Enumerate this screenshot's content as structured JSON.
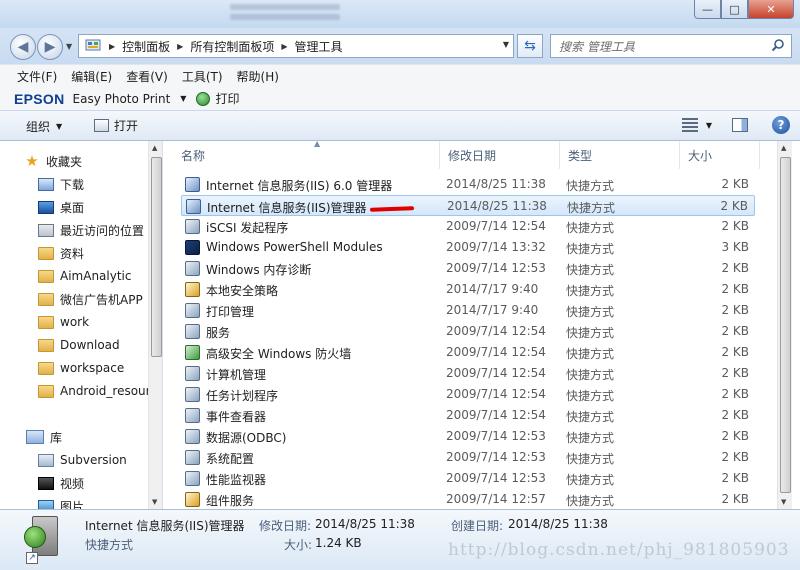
{
  "window": {
    "minimize_label": "—",
    "maximize_label": "□",
    "close_label": "✕"
  },
  "address": {
    "crumbs": [
      "控制面板",
      "所有控制面板项",
      "管理工具"
    ],
    "search_placeholder": "搜索 管理工具"
  },
  "menubar": {
    "items": [
      "文件(F)",
      "编辑(E)",
      "查看(V)",
      "工具(T)",
      "帮助(H)"
    ]
  },
  "epson": {
    "logo": "EPSON",
    "app": "Easy Photo Print",
    "print": "打印"
  },
  "commandbar": {
    "organize": "组织",
    "open": "打开",
    "help": "?"
  },
  "navigation": {
    "favorites_header": "收藏夹",
    "favorites": [
      "下载",
      "桌面",
      "最近访问的位置",
      "资料",
      "AimAnalytic",
      "微信广告机APP",
      "work",
      "Download",
      "workspace",
      "Android_resour"
    ],
    "library_header": "库",
    "library": [
      "Subversion",
      "视频",
      "图片"
    ]
  },
  "columns": {
    "name": "名称",
    "date": "修改日期",
    "type": "类型",
    "size": "大小"
  },
  "files": [
    {
      "name": "Internet 信息服务(IIS) 6.0 管理器",
      "date": "2014/8/25 11:38",
      "type": "快捷方式",
      "size": "2 KB",
      "icon": "iis6-manager-icon"
    },
    {
      "name": "Internet 信息服务(IIS)管理器",
      "date": "2014/8/25 11:38",
      "type": "快捷方式",
      "size": "2 KB",
      "icon": "iis-manager-icon"
    },
    {
      "name": "iSCSI 发起程序",
      "date": "2009/7/14 12:54",
      "type": "快捷方式",
      "size": "2 KB",
      "icon": "iscsi-icon"
    },
    {
      "name": "Windows PowerShell Modules",
      "date": "2009/7/14 13:32",
      "type": "快捷方式",
      "size": "3 KB",
      "icon": "powershell-icon"
    },
    {
      "name": "Windows 内存诊断",
      "date": "2009/7/14 12:53",
      "type": "快捷方式",
      "size": "2 KB",
      "icon": "memory-diagnostic-icon"
    },
    {
      "name": "本地安全策略",
      "date": "2014/7/17 9:40",
      "type": "快捷方式",
      "size": "2 KB",
      "icon": "security-policy-icon"
    },
    {
      "name": "打印管理",
      "date": "2014/7/17 9:40",
      "type": "快捷方式",
      "size": "2 KB",
      "icon": "print-management-icon"
    },
    {
      "name": "服务",
      "date": "2009/7/14 12:54",
      "type": "快捷方式",
      "size": "2 KB",
      "icon": "services-icon"
    },
    {
      "name": "高级安全 Windows 防火墙",
      "date": "2009/7/14 12:54",
      "type": "快捷方式",
      "size": "2 KB",
      "icon": "firewall-icon"
    },
    {
      "name": "计算机管理",
      "date": "2009/7/14 12:54",
      "type": "快捷方式",
      "size": "2 KB",
      "icon": "computer-management-icon"
    },
    {
      "name": "任务计划程序",
      "date": "2009/7/14 12:54",
      "type": "快捷方式",
      "size": "2 KB",
      "icon": "task-scheduler-icon"
    },
    {
      "name": "事件查看器",
      "date": "2009/7/14 12:54",
      "type": "快捷方式",
      "size": "2 KB",
      "icon": "event-viewer-icon"
    },
    {
      "name": "数据源(ODBC)",
      "date": "2009/7/14 12:53",
      "type": "快捷方式",
      "size": "2 KB",
      "icon": "odbc-icon"
    },
    {
      "name": "系统配置",
      "date": "2009/7/14 12:53",
      "type": "快捷方式",
      "size": "2 KB",
      "icon": "system-config-icon"
    },
    {
      "name": "性能监视器",
      "date": "2009/7/14 12:53",
      "type": "快捷方式",
      "size": "2 KB",
      "icon": "performance-monitor-icon"
    },
    {
      "name": "组件服务",
      "date": "2009/7/14 12:57",
      "type": "快捷方式",
      "size": "2 KB",
      "icon": "component-services-icon"
    }
  ],
  "selected_index": 1,
  "details": {
    "name": "Internet 信息服务(IIS)管理器",
    "type": "快捷方式",
    "modified_label": "修改日期:",
    "modified_value": "2014/8/25 11:38",
    "created_label": "创建日期:",
    "created_value": "2014/8/25 11:38",
    "size_label": "大小:",
    "size_value": "1.24 KB",
    "watermark": "http://blog.csdn.net/phj_981805903"
  }
}
